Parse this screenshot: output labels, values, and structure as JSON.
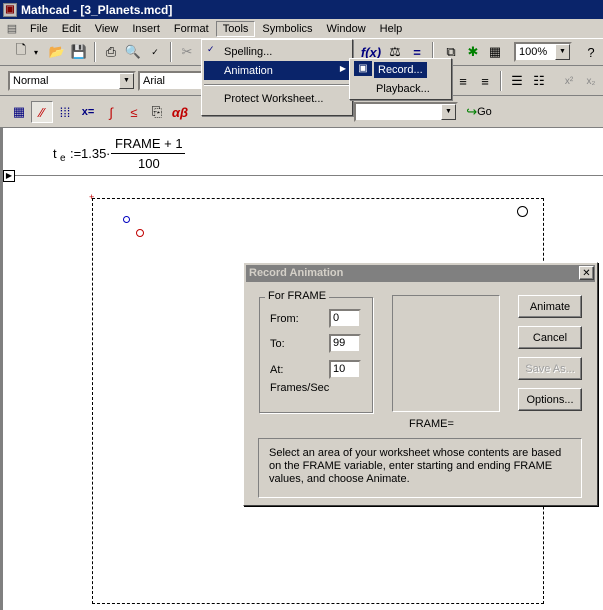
{
  "window": {
    "title": "Mathcad - [3_Planets.mcd]"
  },
  "menubar": {
    "items": [
      "File",
      "Edit",
      "View",
      "Insert",
      "Format",
      "Tools",
      "Symbolics",
      "Window",
      "Help"
    ],
    "active": "Tools"
  },
  "formatting": {
    "style": "Normal",
    "font": "Arial",
    "zoom": "100%"
  },
  "math_toolbar": {
    "go_label": "Go"
  },
  "tools_menu": {
    "items": [
      "Spelling...",
      "Animation",
      "Protect Worksheet..."
    ],
    "highlighted": "Animation"
  },
  "animation_submenu": {
    "items": [
      "Record...",
      "Playback..."
    ],
    "highlighted": "Record..."
  },
  "worksheet": {
    "equation": {
      "lhs": "t",
      "subscript": "e",
      "assign": ":=",
      "coefficient": "1.35",
      "numerator": "FRAME + 1",
      "denominator": "100"
    }
  },
  "dialog": {
    "title": "Record Animation",
    "group_label": "For FRAME",
    "from_label": "From:",
    "from_value": "0",
    "to_label": "To:",
    "to_value": "99",
    "at_label": "At:",
    "at_value": "10",
    "rate_label": "Frames/Sec",
    "preview_label": "FRAME=",
    "buttons": {
      "animate": "Animate",
      "cancel": "Cancel",
      "save_as": "Save As...",
      "options": "Options..."
    },
    "help_text": "Select an area of your worksheet whose contents are based on the FRAME variable, enter starting and ending FRAME values, and choose Animate."
  }
}
